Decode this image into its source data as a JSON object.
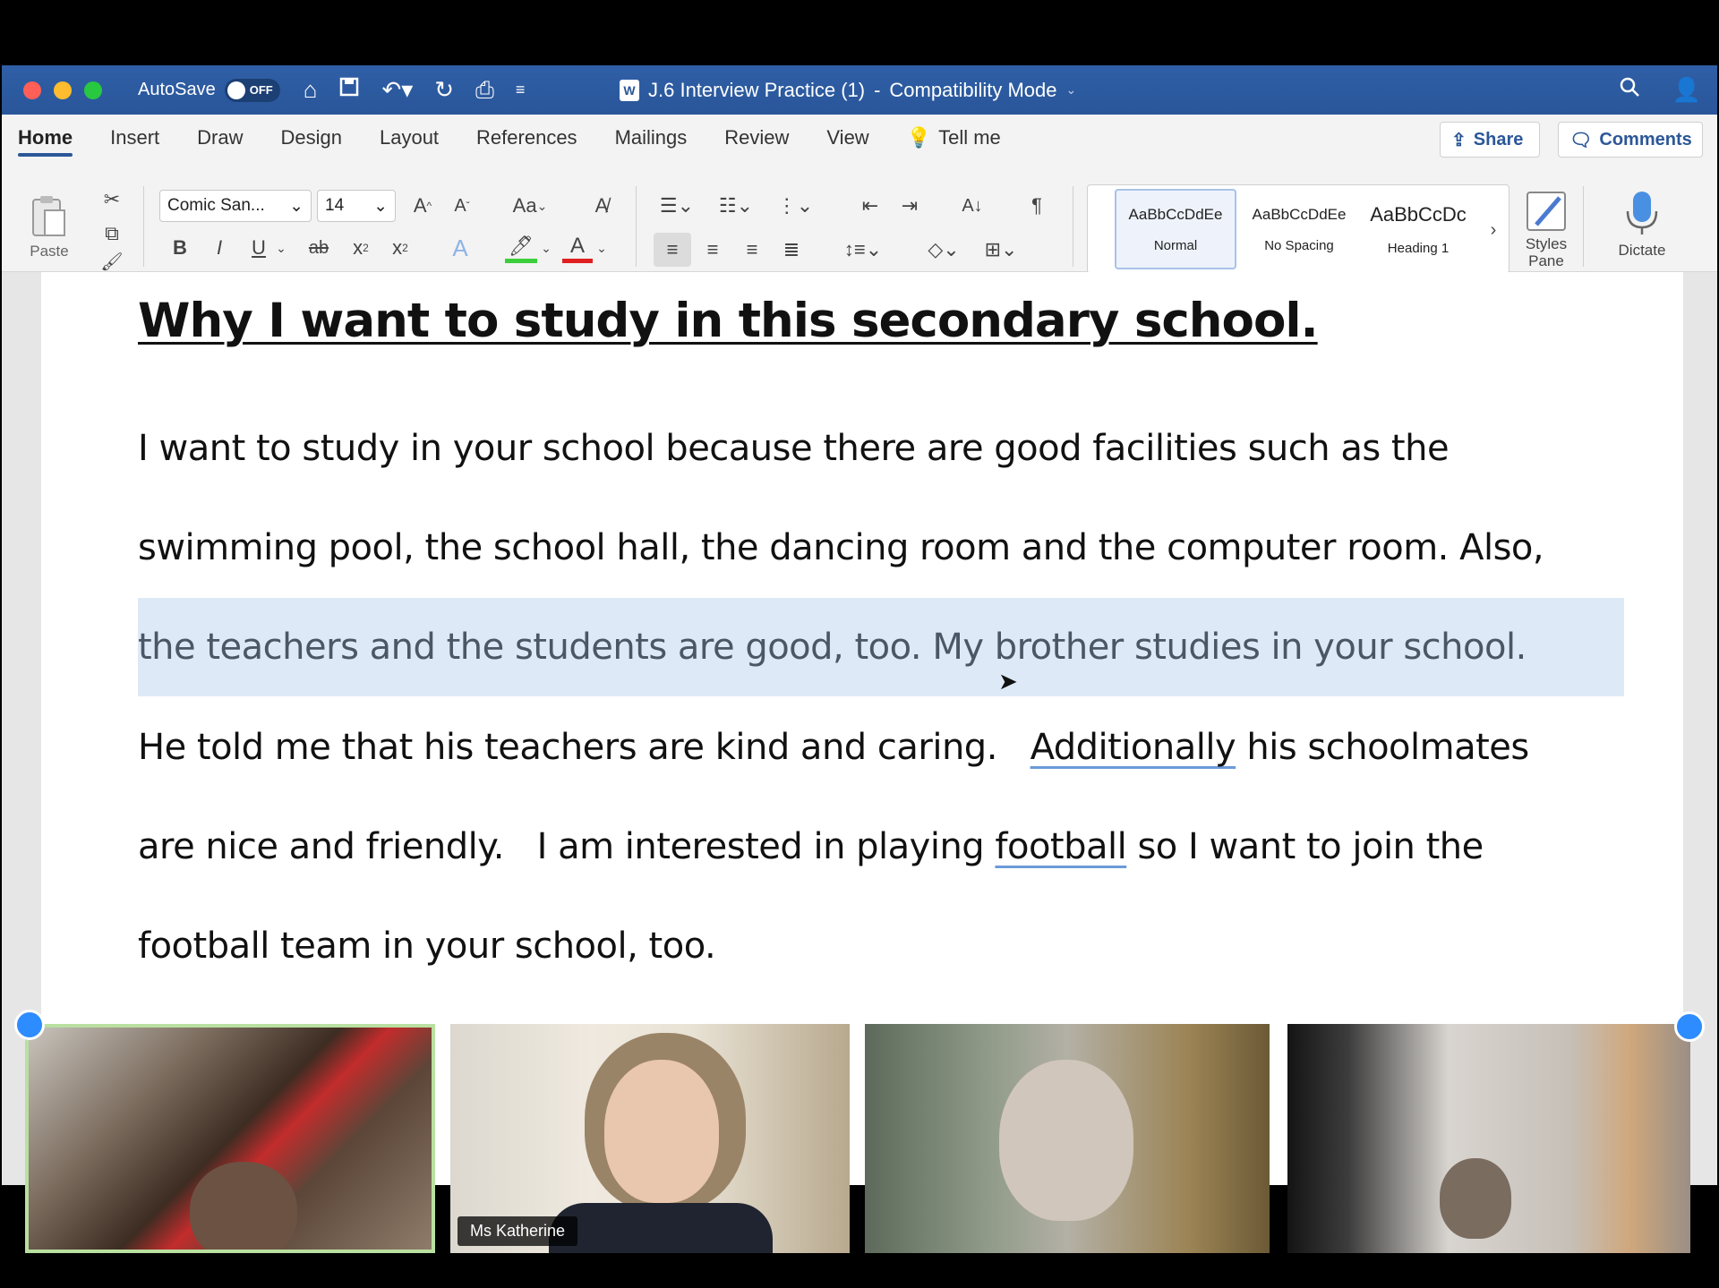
{
  "titlebar": {
    "autosave_label": "AutoSave",
    "autosave_state": "OFF",
    "doc_title": "J.6 Interview Practice (1)",
    "separator": "-",
    "mode": "Compatibility Mode",
    "accent": "#2b5797"
  },
  "tabs": [
    "Home",
    "Insert",
    "Draw",
    "Design",
    "Layout",
    "References",
    "Mailings",
    "Review",
    "View"
  ],
  "tell_me": "Tell me",
  "share_label": "Share",
  "comments_label": "Comments",
  "ribbon": {
    "paste_label": "Paste",
    "font_name": "Comic San...",
    "font_size": "14",
    "change_case": "Aa",
    "bold": "B",
    "italic": "I",
    "underline": "U",
    "strike": "ab",
    "styles": [
      {
        "preview": "AaBbCcDdEe",
        "name": "Normal"
      },
      {
        "preview": "AaBbCcDdEe",
        "name": "No Spacing"
      },
      {
        "preview": "AaBbCcDc",
        "name": "Heading 1"
      }
    ],
    "styles_pane_label_1": "Styles",
    "styles_pane_label_2": "Pane",
    "dictate_label": "Dictate"
  },
  "document": {
    "heading": "Why I want to study in this secondary school.",
    "line1": "I want to study in your school because there are good facilities such as the",
    "line2": "swimming pool, the school hall, the dancing room and the computer room.   Also,",
    "line3": "the teachers and the students are good, too.   My brother studies in your school.",
    "line4_a": "He told me that his teachers are kind and caring.   ",
    "line4_b": "Additionally",
    "line4_c": " his schoolmates",
    "line5_a": "are nice and friendly.   I am interested in playing ",
    "line5_b": "football",
    "line5_c": " so I want to join the",
    "line6": "football team in your school, too."
  },
  "participants": [
    {
      "name": ""
    },
    {
      "name": "Ms Katherine"
    },
    {
      "name": ""
    },
    {
      "name": ""
    }
  ]
}
